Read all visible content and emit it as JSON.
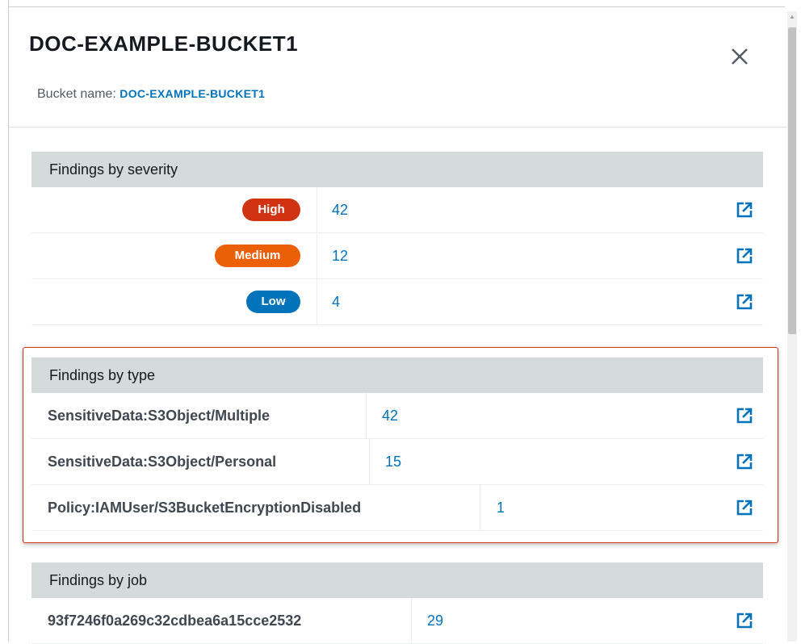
{
  "panel": {
    "title": "DOC-EXAMPLE-BUCKET1",
    "bucket_label": "Bucket name: ",
    "bucket_link": "DOC-EXAMPLE-BUCKET1",
    "close_icon": "close-icon"
  },
  "severity": {
    "heading": "Findings by severity",
    "rows": [
      {
        "label": "High",
        "count": "42",
        "color": "#d13212"
      },
      {
        "label": "Medium",
        "count": "12",
        "color": "#eb5f07"
      },
      {
        "label": "Low",
        "count": "4",
        "color": "#0073bb"
      }
    ]
  },
  "by_type": {
    "heading": "Findings by type",
    "rows": [
      {
        "label": "SensitiveData:S3Object/Multiple",
        "count": "42"
      },
      {
        "label": "SensitiveData:S3Object/Personal",
        "count": "15"
      },
      {
        "label": "Policy:IAMUser/S3BucketEncryptionDisabled",
        "count": "1"
      }
    ]
  },
  "by_job": {
    "heading": "Findings by job",
    "rows": [
      {
        "label": "93f7246f0a269c32cdbea6a15cce2532",
        "count": "29"
      }
    ]
  },
  "colors": {
    "link": "#0073bb",
    "section_header_bg": "#d5dbdb",
    "highlight_border": "#d13212"
  }
}
